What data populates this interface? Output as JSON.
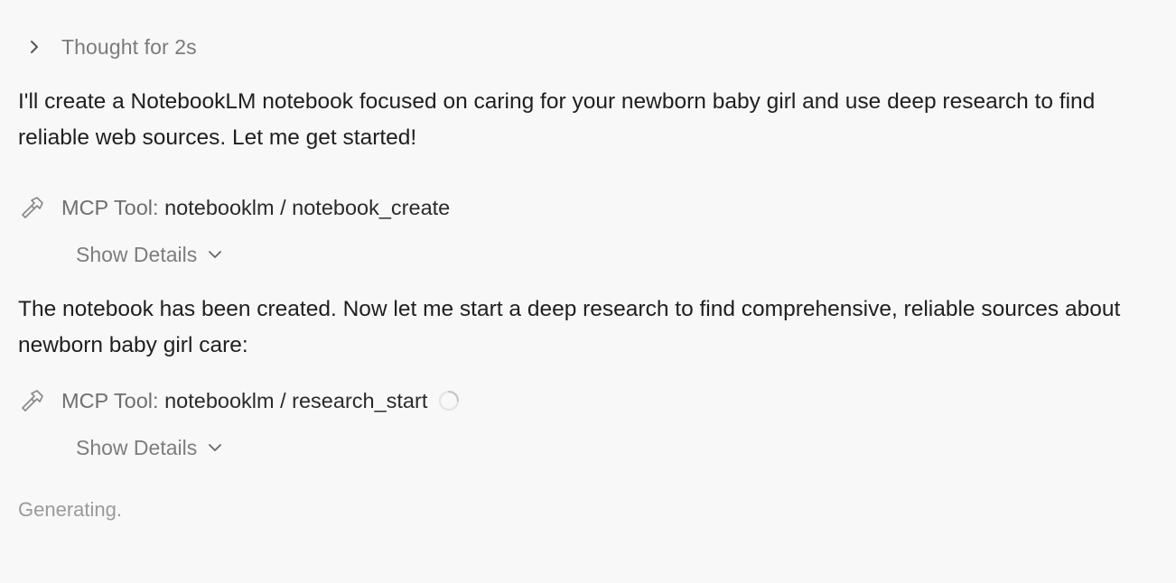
{
  "thought": {
    "label": "Thought for 2s",
    "icon": "chevron-right-icon"
  },
  "messages": [
    "I'll create a NotebookLM notebook focused on caring for your newborn baby girl and use deep research to find reliable web sources. Let me get started!",
    "The notebook has been created. Now let me start a deep research to find comprehensive, reliable sources about newborn baby girl care:"
  ],
  "tools": [
    {
      "prefix": "MCP Tool:",
      "name": "notebooklm / notebook_create",
      "icon": "hammer-icon",
      "details_label": "Show Details",
      "loading": false
    },
    {
      "prefix": "MCP Tool:",
      "name": "notebooklm / research_start",
      "icon": "hammer-icon",
      "details_label": "Show Details",
      "loading": true
    }
  ],
  "status": "Generating.",
  "colors": {
    "background": "#f8f8f8",
    "text": "#1f1f1f",
    "muted": "#7b7b7b"
  }
}
